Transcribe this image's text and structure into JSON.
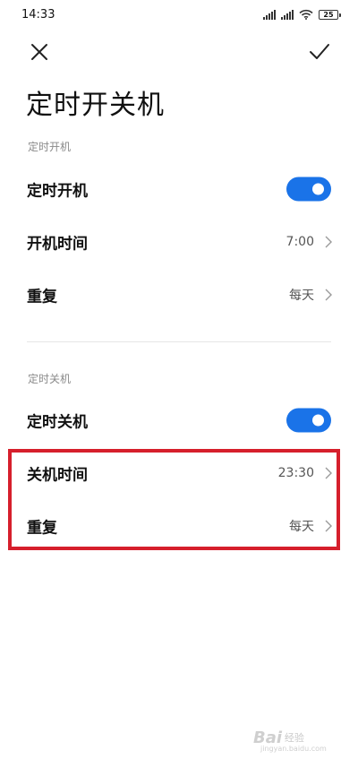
{
  "status_bar": {
    "time": "14:33",
    "battery": "25"
  },
  "header": {
    "title": "定时开关机"
  },
  "power_on": {
    "section_title": "定时开机",
    "toggle_label": "定时开机",
    "toggle_on": true,
    "time_label": "开机时间",
    "time_value": "7:00",
    "repeat_label": "重复",
    "repeat_value": "每天"
  },
  "power_off": {
    "section_title": "定时关机",
    "toggle_label": "定时关机",
    "toggle_on": true,
    "time_label": "关机时间",
    "time_value": "23:30",
    "repeat_label": "重复",
    "repeat_value": "每天"
  },
  "watermark": {
    "logo": "Bai",
    "text": "经验",
    "url": "jingyan.baidu.com"
  },
  "colors": {
    "accent": "#1a73e8",
    "highlight": "#d61f2c"
  },
  "icons": [
    "close-icon",
    "check-icon",
    "chevron-right-icon",
    "signal-icon",
    "wifi-icon",
    "battery-icon"
  ]
}
